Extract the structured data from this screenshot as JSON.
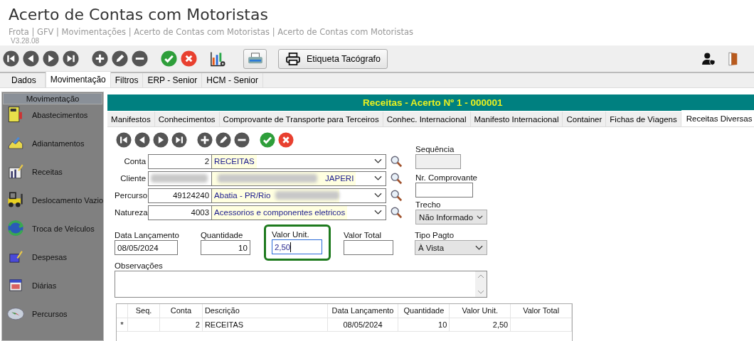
{
  "window": {
    "title": "Acerto de Contas com Motoristas",
    "breadcrumb": "Frota | GFV | Movimentações | Acerto de Contas com Motoristas | Acerto de Contas com Motoristas",
    "version": "V3.28.08"
  },
  "toolbar": {
    "nav": [
      {
        "kind": "first"
      },
      {
        "kind": "prev"
      },
      {
        "kind": "next"
      },
      {
        "kind": "last"
      }
    ],
    "edit": [
      {
        "kind": "add"
      },
      {
        "kind": "edit"
      },
      {
        "kind": "remove"
      }
    ],
    "confirm": [
      {
        "kind": "ok"
      },
      {
        "kind": "cancel"
      }
    ],
    "label_button": "Etiqueta Tacógrafo"
  },
  "tabs": [
    {
      "label": "Dados",
      "selected": false
    },
    {
      "label": "Movimentação",
      "selected": true
    },
    {
      "label": "Filtros",
      "selected": false
    },
    {
      "label": "ERP - Senior",
      "selected": false
    },
    {
      "label": "HCM - Senior",
      "selected": false
    }
  ],
  "sidebar": {
    "title": "Movimentação",
    "items": [
      {
        "label": "Abastecimentos",
        "kind": "fuel"
      },
      {
        "label": "Adiantamentos",
        "kind": "advance"
      },
      {
        "label": "Receitas",
        "kind": "receipt"
      },
      {
        "label": "Deslocamento Vazio",
        "kind": "truck"
      },
      {
        "label": "Troca de Veículos",
        "kind": "swap"
      },
      {
        "label": "Despesas",
        "kind": "expense"
      },
      {
        "label": "Diárias",
        "kind": "calendar"
      },
      {
        "label": "Percursos",
        "kind": "compass"
      }
    ]
  },
  "panel": {
    "title": "Receitas - Acerto Nº 1 - 000001",
    "tabs": [
      {
        "label": "Manifestos",
        "selected": false
      },
      {
        "label": "Conhecimentos",
        "selected": false
      },
      {
        "label": "Comprovante de Transporte para Terceiros",
        "selected": false
      },
      {
        "label": "Conhec. Internacional",
        "selected": false
      },
      {
        "label": "Manifesto Internacional",
        "selected": false
      },
      {
        "label": "Container",
        "selected": false
      },
      {
        "label": "Fichas de Viagens",
        "selected": false
      },
      {
        "label": "Receitas Diversas",
        "selected": true
      }
    ],
    "lookups": [
      {
        "label": "Conta",
        "code": "2",
        "code_redacted": false,
        "blur_before": false,
        "blur_after": false,
        "description": "RECEITAS"
      },
      {
        "label": "Cliente",
        "code_redacted": true,
        "blur_before": true,
        "blur_after": false,
        "description": "JAPERI"
      },
      {
        "label": "Percurso",
        "code": "49124240",
        "code_redacted": false,
        "blur_before": false,
        "blur_after": true,
        "description": "Abatia - PR/Rio"
      },
      {
        "label": "Natureza",
        "code": "4003",
        "code_redacted": false,
        "blur_before": false,
        "blur_after": false,
        "description": "Acessorios e componentes eletricos"
      }
    ],
    "sequencia": {
      "label": "Sequência",
      "disabled": true
    },
    "comprovante": {
      "label": "Nr. Comprovante"
    },
    "trecho": {
      "label": "Trecho",
      "value": "Não Informado"
    },
    "values": [
      {
        "label": "Data Lançamento",
        "value": "08/05/2024",
        "focused": false
      },
      {
        "label": "Quantidade",
        "value": "10",
        "focused": false
      },
      {
        "label": "Valor Unit.",
        "value": "2,50",
        "focused": true
      },
      {
        "label": "Valor Total",
        "focused": false
      }
    ],
    "tipo_pagto": {
      "label": "Tipo Pagto",
      "value": "À Vista"
    },
    "observacoes": {
      "label": "Observações"
    },
    "table": {
      "columns": [
        {
          "label": "Seq."
        },
        {
          "label": "Conta"
        },
        {
          "label": "Descrição"
        },
        {
          "label": "Data Lançamento"
        },
        {
          "label": "Quantidade"
        },
        {
          "label": "Valor Unit."
        },
        {
          "label": "Valor Total"
        }
      ],
      "rows": [
        {
          "marker": "*",
          "cells": [
            "",
            "2",
            "RECEITAS",
            "08/05/2024",
            "10",
            "2,50",
            ""
          ]
        }
      ]
    }
  }
}
